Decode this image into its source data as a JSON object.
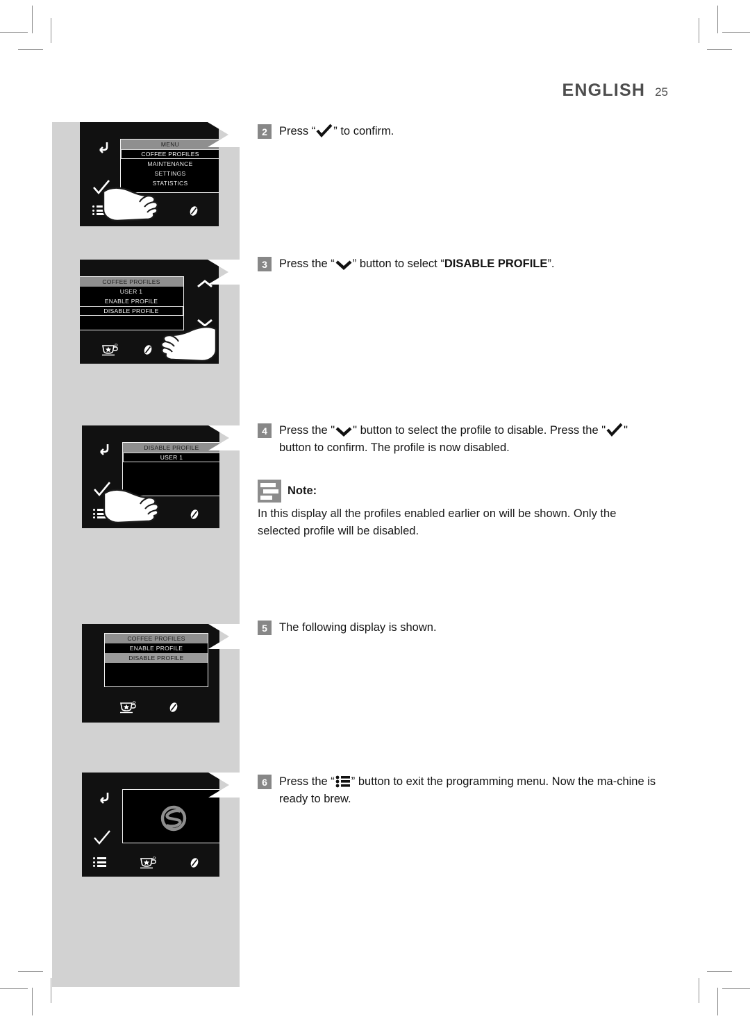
{
  "header": {
    "language": "ENGLISH",
    "page_number": "25"
  },
  "steps": [
    {
      "number": "2",
      "parts": [
        {
          "t": "text",
          "v": "Press “"
        },
        {
          "t": "icon",
          "v": "checkmark-icon"
        },
        {
          "t": "text",
          "v": "” to confirm."
        }
      ],
      "plain": "Press “✓” to confirm."
    },
    {
      "number": "3",
      "parts": [
        {
          "t": "text",
          "v": "Press the “"
        },
        {
          "t": "icon",
          "v": "chevron-down-icon"
        },
        {
          "t": "text",
          "v": "” button to select “"
        },
        {
          "t": "bold",
          "v": "DISABLE PROFILE"
        },
        {
          "t": "text",
          "v": "”."
        }
      ],
      "plain": "Press the “⌄” button to select “DISABLE PROFILE”."
    },
    {
      "number": "4",
      "parts": [
        {
          "t": "text",
          "v": "Press the \""
        },
        {
          "t": "icon",
          "v": "chevron-down-icon"
        },
        {
          "t": "text",
          "v": "\" button to select the profile to disable. Press the \""
        },
        {
          "t": "icon",
          "v": "checkmark-icon"
        },
        {
          "t": "text",
          "v": "\" button to confirm. The profile is now disabled."
        }
      ],
      "plain": "Press the \"⌄\" button to select the profile to disable. Press the \"✓\" button to confirm. The profile is now disabled."
    },
    {
      "number": "5",
      "parts": [
        {
          "t": "text",
          "v": "The following display is shown."
        }
      ],
      "plain": "The following display is shown."
    },
    {
      "number": "6",
      "parts": [
        {
          "t": "text",
          "v": "Press the “"
        },
        {
          "t": "icon",
          "v": "list-menu-icon"
        },
        {
          "t": "text",
          "v": "” button to exit the programming menu. Now the ma-chine is ready to brew."
        }
      ],
      "plain": "Press the “☰” button to exit the programming menu. Now the machine is ready to brew."
    }
  ],
  "note": {
    "icon": "note-icon",
    "title": "Note:",
    "body": "In this display all the profiles enabled earlier on will be shown. Only the selected profile will be disabled."
  },
  "displays": [
    {
      "id": "display-menu",
      "menu_title": "MENU",
      "rows": [
        {
          "label": "MENU",
          "state": "header"
        },
        {
          "label": "COFFEE PROFILES",
          "state": "selected-dark"
        },
        {
          "label": "MAINTENANCE",
          "state": "normal"
        },
        {
          "label": "SETTINGS",
          "state": "normal"
        },
        {
          "label": "STATISTICS",
          "state": "normal"
        }
      ],
      "icons": [
        "back-arrow-icon",
        "checkmark-icon",
        "list-menu-icon",
        "cup-profile-icon",
        "coffee-bean-icon"
      ],
      "hand": true
    },
    {
      "id": "display-coffee-profiles",
      "menu_title": "COFFEE PROFILES",
      "rows": [
        {
          "label": "COFFEE PROFILES",
          "state": "header"
        },
        {
          "label": "USER 1",
          "state": "normal"
        },
        {
          "label": "ENABLE PROFILE",
          "state": "normal"
        },
        {
          "label": "DISABLE PROFILE",
          "state": "selected-dark"
        },
        {
          "label": "",
          "state": "blank"
        }
      ],
      "icons": [
        "chevron-up-icon",
        "chevron-down-icon",
        "cup-profile-icon",
        "coffee-bean-icon",
        "power-icon"
      ],
      "hand": true
    },
    {
      "id": "display-disable-profile",
      "menu_title": "DISABLE PROFILE",
      "rows": [
        {
          "label": "DISABLE PROFILE",
          "state": "header"
        },
        {
          "label": "USER 1",
          "state": "selected-dark"
        },
        {
          "label": "",
          "state": "blank"
        },
        {
          "label": "",
          "state": "blank"
        }
      ],
      "icons": [
        "back-arrow-icon",
        "checkmark-icon",
        "list-menu-icon",
        "cup-profile-icon",
        "coffee-bean-icon"
      ],
      "hand": true
    },
    {
      "id": "display-coffee-profiles-after",
      "menu_title": "COFFEE PROFILES",
      "rows": [
        {
          "label": "COFFEE PROFILES",
          "state": "header"
        },
        {
          "label": "ENABLE PROFILE",
          "state": "normal"
        },
        {
          "label": "DISABLE PROFILE",
          "state": "selected-gray"
        },
        {
          "label": "",
          "state": "blank"
        },
        {
          "label": "",
          "state": "blank"
        }
      ],
      "icons": [
        "cup-profile-icon",
        "coffee-bean-icon"
      ],
      "hand": false
    },
    {
      "id": "display-ready-logo",
      "menu_title": "",
      "rows": [],
      "logo": "brand-logo-icon",
      "icons": [
        "back-arrow-icon",
        "checkmark-icon",
        "list-menu-icon",
        "cup-profile-icon",
        "coffee-bean-icon"
      ],
      "hand": false
    }
  ],
  "colors": {
    "band": "#d2d2d2",
    "display_bg": "#111111",
    "header_row": "#8f8f8f",
    "badge": "#878787",
    "note_icon": "#8c8c8c",
    "text": "#141414"
  }
}
